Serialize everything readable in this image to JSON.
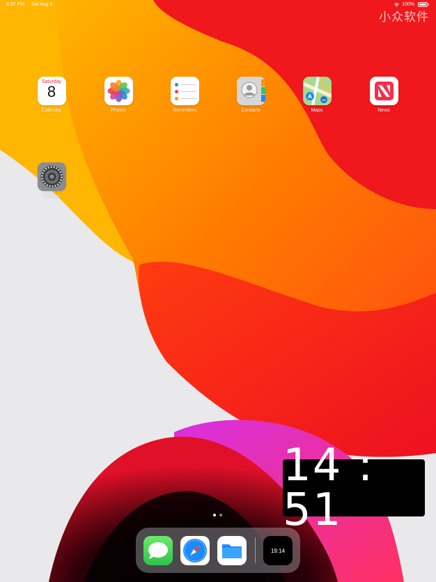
{
  "status_bar": {
    "time": "8:37 PM",
    "date": "Sat Aug 8",
    "battery": "100%",
    "battery_level": 1.0
  },
  "watermark": "小众软件",
  "apps": [
    {
      "label": "Calendar",
      "icon": "calendar-icon",
      "day_name": "Saturday",
      "day_number": "8"
    },
    {
      "label": "Photos",
      "icon": "photos-icon"
    },
    {
      "label": "Reminders",
      "icon": "reminders-icon"
    },
    {
      "label": "Contacts",
      "icon": "contacts-icon"
    },
    {
      "label": "Maps",
      "icon": "maps-icon",
      "badge_text": "280"
    },
    {
      "label": "News",
      "icon": "news-icon"
    },
    {
      "label": "Settings",
      "icon": "settings-icon"
    }
  ],
  "page_indicator": {
    "pages": 2,
    "current": 1
  },
  "dock": {
    "apps": [
      {
        "name": "Messages",
        "icon": "messages-icon"
      },
      {
        "name": "Safari",
        "icon": "safari-icon"
      },
      {
        "name": "Files",
        "icon": "files-icon"
      },
      {
        "name": "Clock",
        "icon": "clock-app-icon",
        "time": "19:14"
      }
    ]
  },
  "pip_clock": {
    "time": "14 : 51"
  },
  "colors": {
    "wallpaper_red": "#f5222a",
    "wallpaper_orange": "#ff6a00",
    "wallpaper_yellow": "#ffb800",
    "wallpaper_magenta": "#e234e8",
    "wallpaper_grey": "#e8e8ea"
  }
}
